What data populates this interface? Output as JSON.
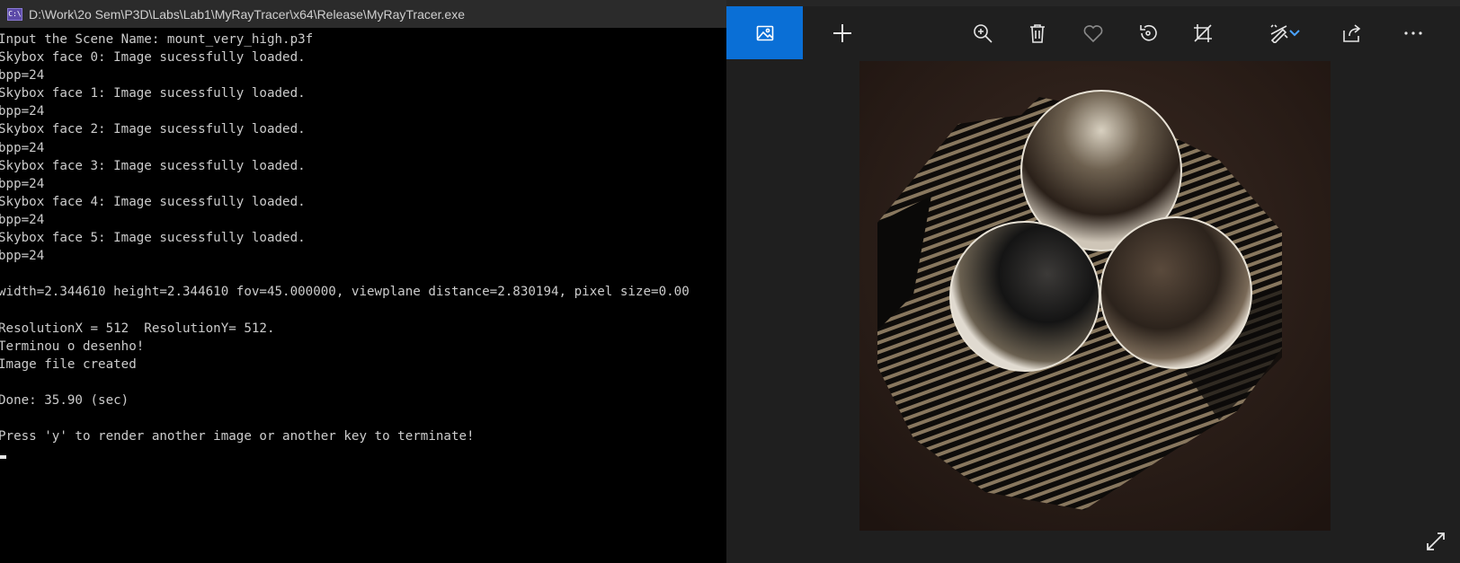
{
  "console": {
    "title": "D:\\Work\\2o Sem\\P3D\\Labs\\Lab1\\MyRayTracer\\x64\\Release\\MyRayTracer.exe",
    "app_icon_label": "C:\\",
    "lines": [
      "Input the Scene Name: mount_very_high.p3f",
      "Skybox face 0: Image sucessfully loaded.",
      "bpp=24",
      "Skybox face 1: Image sucessfully loaded.",
      "bpp=24",
      "Skybox face 2: Image sucessfully loaded.",
      "bpp=24",
      "Skybox face 3: Image sucessfully loaded.",
      "bpp=24",
      "Skybox face 4: Image sucessfully loaded.",
      "bpp=24",
      "Skybox face 5: Image sucessfully loaded.",
      "bpp=24",
      "",
      "width=2.344610 height=2.344610 fov=45.000000, viewplane distance=2.830194, pixel size=0.00",
      "",
      "ResolutionX = 512  ResolutionY= 512.",
      "Terminou o desenho!",
      "Image file created",
      "",
      "Done: 35.90 (sec)",
      "",
      "Press 'y' to render another image or another key to terminate!"
    ]
  },
  "viewer": {
    "accent": "#0a6fd6",
    "toolbar": [
      {
        "name": "image-view-icon"
      },
      {
        "name": "add-icon"
      },
      {
        "name": "zoom-icon"
      },
      {
        "name": "delete-icon"
      },
      {
        "name": "favorite-icon"
      },
      {
        "name": "rotate-icon"
      },
      {
        "name": "crop-icon"
      },
      {
        "name": "edit-icon"
      },
      {
        "name": "dropdown-chevron-icon"
      },
      {
        "name": "share-icon"
      },
      {
        "name": "more-icon"
      }
    ],
    "image_description_icon": "rendered-image",
    "fullscreen_icon": "expand-icon"
  }
}
